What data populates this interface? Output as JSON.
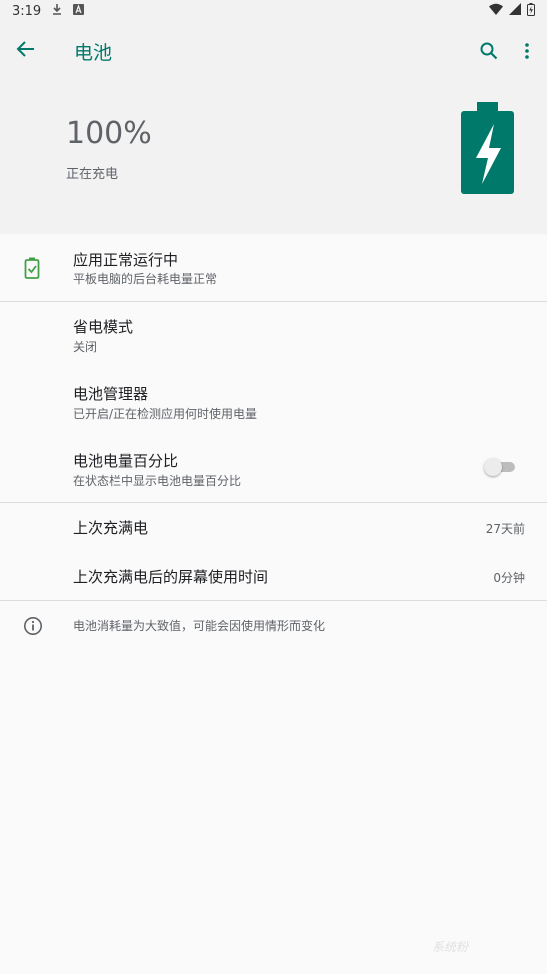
{
  "status_bar": {
    "time": "3:19",
    "icons": [
      "download-icon",
      "a-notification-icon",
      "wifi-icon",
      "signal-icon",
      "battery-charging-icon"
    ]
  },
  "app_bar": {
    "title": "电池",
    "accent_color": "#00796b"
  },
  "header": {
    "level": "100%",
    "status": "正在充电",
    "battery_color": "#00796b"
  },
  "app_status": {
    "title": "应用正常运行中",
    "subtitle": "平板电脑的后台耗电量正常",
    "icon": "battery-check-icon",
    "icon_color": "#43a047"
  },
  "settings": {
    "power_saving": {
      "title": "省电模式",
      "subtitle": "关闭"
    },
    "battery_manager": {
      "title": "电池管理器",
      "subtitle": "已开启/正在检测应用何时使用电量"
    },
    "battery_percentage": {
      "title": "电池电量百分比",
      "subtitle": "在状态栏中显示电池电量百分比",
      "enabled": false
    }
  },
  "usage": {
    "last_full_charge": {
      "title": "上次充满电",
      "value": "27天前"
    },
    "screen_usage": {
      "title": "上次充满电后的屏幕使用时间",
      "value": "0分钟"
    }
  },
  "footer": {
    "info_text": "电池消耗量为大致值，可能会因使用情形而变化",
    "icon": "info-icon"
  },
  "watermark": "系统粉"
}
